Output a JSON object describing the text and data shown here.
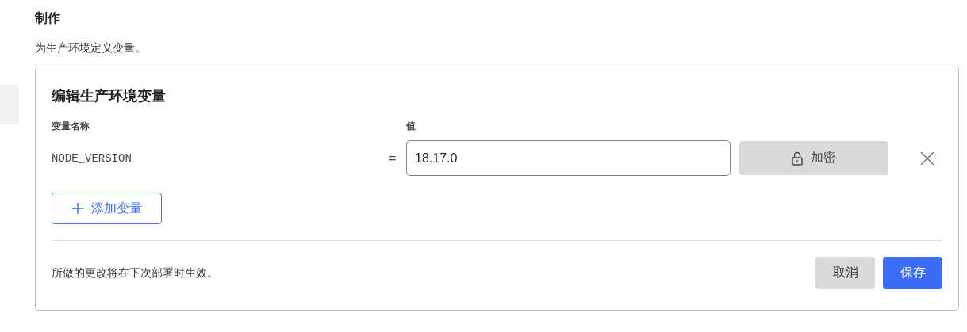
{
  "section": {
    "title": "制作",
    "description": "为生产环境定义变量。"
  },
  "card": {
    "title": "编辑生产环境变量",
    "columns": [
      "变量名称",
      "值"
    ],
    "variables": [
      {
        "name": "NODE_VERSION",
        "separator": "=",
        "value": "18.17.0",
        "encrypt_label": "加密"
      }
    ],
    "add_label": "添加变量",
    "footer_note": "所做的更改将在下次部署时生效。",
    "cancel_label": "取消",
    "save_label": "保存"
  }
}
